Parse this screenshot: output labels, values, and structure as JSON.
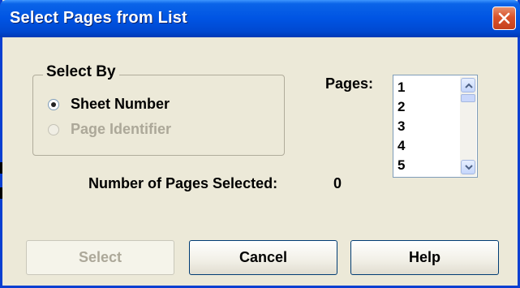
{
  "window": {
    "title": "Select Pages from List"
  },
  "group": {
    "label": "Select By",
    "options": [
      {
        "label": "Sheet Number",
        "selected": true,
        "enabled": true
      },
      {
        "label": "Page Identifier",
        "selected": false,
        "enabled": false
      }
    ]
  },
  "pages": {
    "label": "Pages:",
    "items": [
      "1",
      "2",
      "3",
      "4",
      "5"
    ]
  },
  "status": {
    "label": "Number of Pages Selected:",
    "count": "0"
  },
  "buttons": {
    "select": "Select",
    "cancel": "Cancel",
    "help": "Help"
  },
  "colors": {
    "titlebar": "#0054e3",
    "face": "#ece9d8",
    "close": "#d9532b",
    "disabled_text": "#aca899"
  },
  "icons": {
    "close": "close-icon",
    "scroll_up": "scroll-up-icon",
    "scroll_down": "scroll-down-icon"
  }
}
